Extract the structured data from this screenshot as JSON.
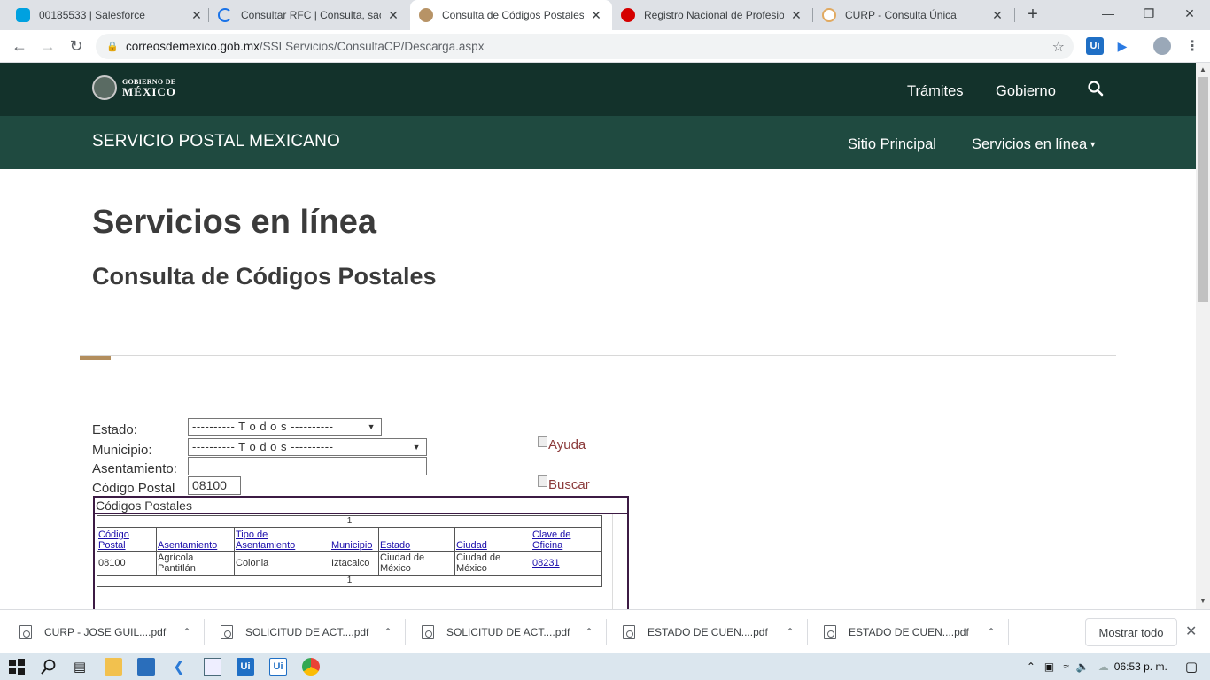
{
  "browser": {
    "tabs": [
      {
        "title": "00185533 | Salesforce",
        "icon": "salesforce-icon",
        "color": "#00a1e0",
        "close": "✕"
      },
      {
        "title": "Consultar RFC | Consulta, saca",
        "icon": "loading-icon",
        "color": "#1a73e8",
        "close": "✕"
      },
      {
        "title": "Consulta de Códigos Postales",
        "icon": "correos-icon",
        "color": "#b79366",
        "close": "✕"
      },
      {
        "title": "Registro Nacional de Profesion",
        "icon": "registro-icon",
        "color": "#d50000",
        "close": "✕"
      },
      {
        "title": "CURP - Consulta Única",
        "icon": "curp-icon",
        "color": "#e1a95f",
        "close": "✕"
      }
    ],
    "new_tab": "+",
    "url_host": "correosdemexico.gob.mx",
    "url_path": "/SSLServicios/ConsultaCP/Descarga.aspx",
    "extensions": [
      {
        "label": "Ui",
        "color": "#1f6fc5"
      },
      {
        "label": "▶",
        "color": "#2a7ae2"
      }
    ]
  },
  "gov_header": {
    "logo_line1": "GOBIERNO DE",
    "logo_line2": "MÉXICO",
    "nav": [
      "Trámites",
      "Gobierno"
    ]
  },
  "sub_header": {
    "title": "SERVICIO POSTAL MEXICANO",
    "nav": [
      "Sitio Principal",
      "Servicios en línea"
    ]
  },
  "main": {
    "heading": "Servicios en línea",
    "subheading": "Consulta de Códigos Postales"
  },
  "form": {
    "estado_label": "Estado:",
    "estado_value": "---------- T o d o s ----------",
    "municipio_label": "Municipio:",
    "municipio_value": "---------- T o d o s ----------",
    "asentamiento_label": "Asentamiento:",
    "asentamiento_value": "",
    "cp_label": "Código Postal",
    "cp_value": "08100",
    "ayuda_alt": "Ayuda",
    "buscar_alt": "Buscar"
  },
  "results": {
    "title": "Códigos Postales",
    "pager": "1",
    "headers": [
      "Código Postal",
      "Asentamiento",
      "Tipo de Asentamiento",
      "Municipio",
      "Estado",
      "Ciudad",
      "Clave de Oficina"
    ],
    "rows": [
      [
        "08100",
        "Agrícola Pantitlán",
        "Colonia",
        "Iztacalco",
        "Ciudad de México",
        "Ciudad de México",
        "08231"
      ]
    ]
  },
  "downloads": {
    "items": [
      "CURP - JOSE GUIL....pdf",
      "SOLICITUD DE ACT....pdf",
      "SOLICITUD DE ACT....pdf",
      "ESTADO DE CUEN....pdf",
      "ESTADO DE CUEN....pdf"
    ],
    "show_all": "Mostrar todo"
  },
  "taskbar": {
    "time": "06:53 p. m."
  }
}
